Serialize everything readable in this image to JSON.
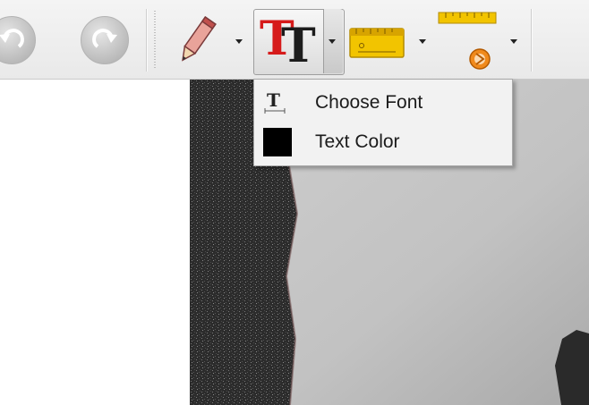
{
  "toolbar": {
    "buttons": [
      {
        "name": "undo",
        "icon": "undo-icon"
      },
      {
        "name": "redo",
        "icon": "redo-icon"
      },
      {
        "name": "pencil",
        "icon": "pencil-icon"
      },
      {
        "name": "text",
        "icon": "text-tool-icon"
      },
      {
        "name": "ruler",
        "icon": "ruler-icon"
      },
      {
        "name": "protractor",
        "icon": "measure-angle-icon"
      }
    ]
  },
  "menu": {
    "items": [
      {
        "label": "Choose Font",
        "icon": "font-icon"
      },
      {
        "label": "Text Color",
        "icon": "color-swatch-icon",
        "swatch_color": "#000000"
      }
    ]
  },
  "colors": {
    "text_tool_red": "#d61b1b",
    "ruler_yellow": "#f2c400",
    "angle_orange": "#f08a1c"
  }
}
